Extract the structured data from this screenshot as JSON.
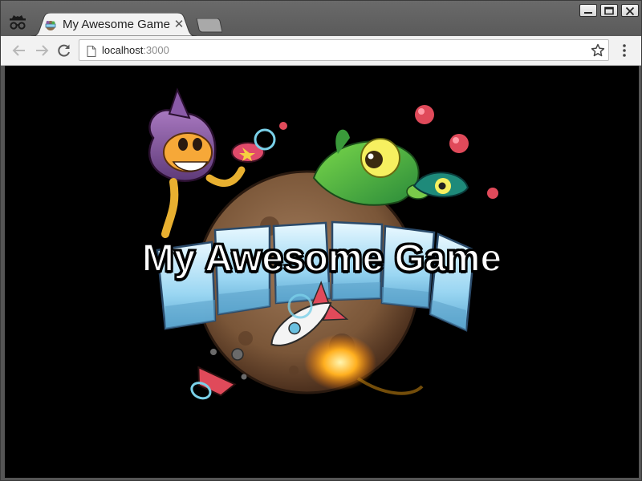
{
  "browser": {
    "tab": {
      "title": "My Awesome Game",
      "close_glyph": "✕",
      "favicon": "phaser-favicon-icon"
    },
    "address": {
      "host": "localhost",
      "port": ":3000"
    },
    "icons": {
      "incognito": "incognito-icon",
      "back": "arrow-left-icon",
      "forward": "arrow-right-icon",
      "reload": "reload-icon",
      "page": "page-icon",
      "bookmark": "star-icon",
      "menu": "kebab-menu-icon"
    },
    "window_controls": [
      "minimize",
      "maximize",
      "close"
    ]
  },
  "game": {
    "title_text": "My Awesome Game",
    "background": "#000000",
    "logo": "phaser-logo"
  },
  "colors": {
    "tab_active": "#f2f2f2",
    "chrome_frame": "#5a5a5a",
    "title_text": "#ffffff"
  }
}
